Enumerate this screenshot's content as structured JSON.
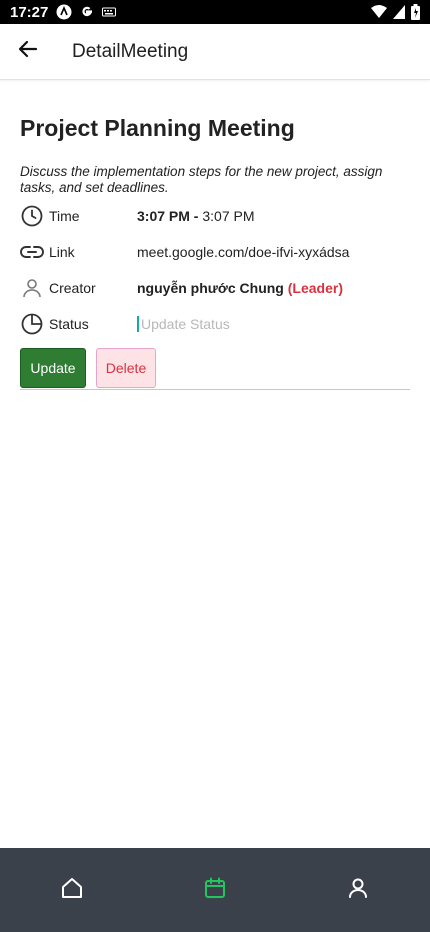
{
  "status_bar": {
    "time": "17:27",
    "icons": [
      "android-icon",
      "google-g-icon",
      "keyboard-icon",
      "wifi-icon",
      "signal-icon",
      "battery-icon"
    ]
  },
  "app_bar": {
    "title": "DetailMeeting",
    "back_icon": "arrow-left-icon"
  },
  "meeting": {
    "title": "Project Planning Meeting",
    "description": " Discuss the implementation steps for the new project, assign tasks, and set deadlines.",
    "time": {
      "label": "Time",
      "start": "3:07 PM -",
      "end": " 3:07 PM",
      "icon": "clock-icon"
    },
    "link": {
      "label": "Link",
      "value": "meet.google.com/doe-ifvi-xyxádsa",
      "icon": "link-icon"
    },
    "creator": {
      "label": "Creator",
      "name": "nguyễn phước Chung",
      "role": "(Leader)",
      "icon": "person-icon"
    },
    "status": {
      "label": "Status",
      "placeholder": "Update Status",
      "value": "",
      "icon": "pie-chart-icon"
    }
  },
  "actions": {
    "update_label": "Update",
    "delete_label": "Delete"
  },
  "bottom_nav": {
    "items": [
      {
        "name": "home",
        "icon": "home-icon",
        "active": false
      },
      {
        "name": "calendar",
        "icon": "calendar-icon",
        "active": true
      },
      {
        "name": "profile",
        "icon": "user-icon",
        "active": false
      }
    ],
    "active_color": "#22c55e",
    "inactive_color": "#ffffff",
    "background": "#3a414b"
  },
  "colors": {
    "update_button": "#2e7d32",
    "delete_button_bg": "#fde2e6",
    "delete_text": "#d9323f",
    "leader": "#d9323f"
  }
}
